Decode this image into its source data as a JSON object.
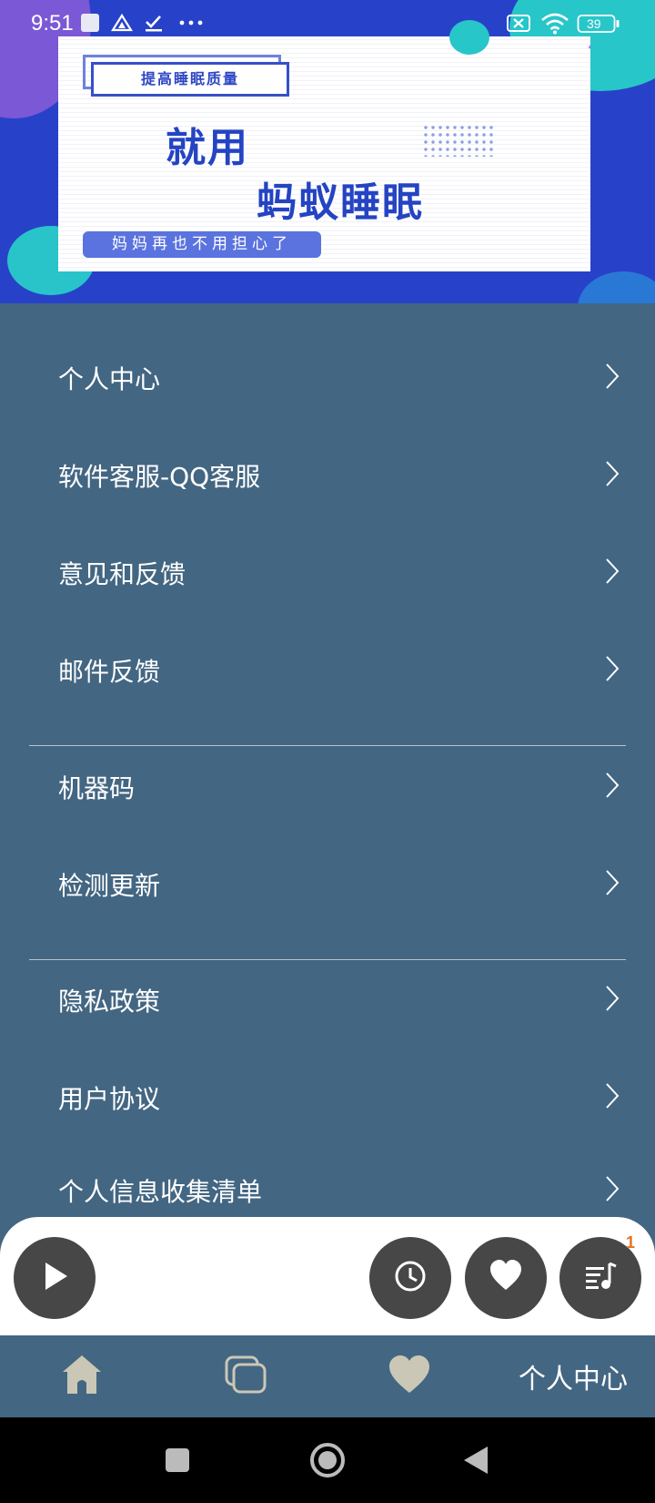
{
  "status_bar": {
    "time": "9:51",
    "battery": "39"
  },
  "banner": {
    "tag": "提高睡眠质量",
    "title_line1": "就用",
    "title_line2": "蚂蚁睡眠",
    "note": "妈妈再也不用担心了"
  },
  "menu": [
    {
      "label": "个人中心"
    },
    {
      "label": "软件客服-QQ客服"
    },
    {
      "label": "意见和反馈"
    },
    {
      "label": "邮件反馈"
    },
    {
      "label": "机器码"
    },
    {
      "label": "检测更新"
    },
    {
      "label": "隐私政策"
    },
    {
      "label": "用户协议"
    },
    {
      "label": "个人信息收集清单"
    }
  ],
  "player": {
    "playlist_badge": "1"
  },
  "tabs": {
    "home_icon": "home-icon",
    "category_icon": "layers-icon",
    "favorites_icon": "heart-icon",
    "profile_label": "个人中心"
  },
  "colors": {
    "banner_bg": "#2742c9",
    "page_bg": "#436682",
    "accent_blue": "#2444c3",
    "player_button": "#474747",
    "badge": "#e3731f"
  }
}
